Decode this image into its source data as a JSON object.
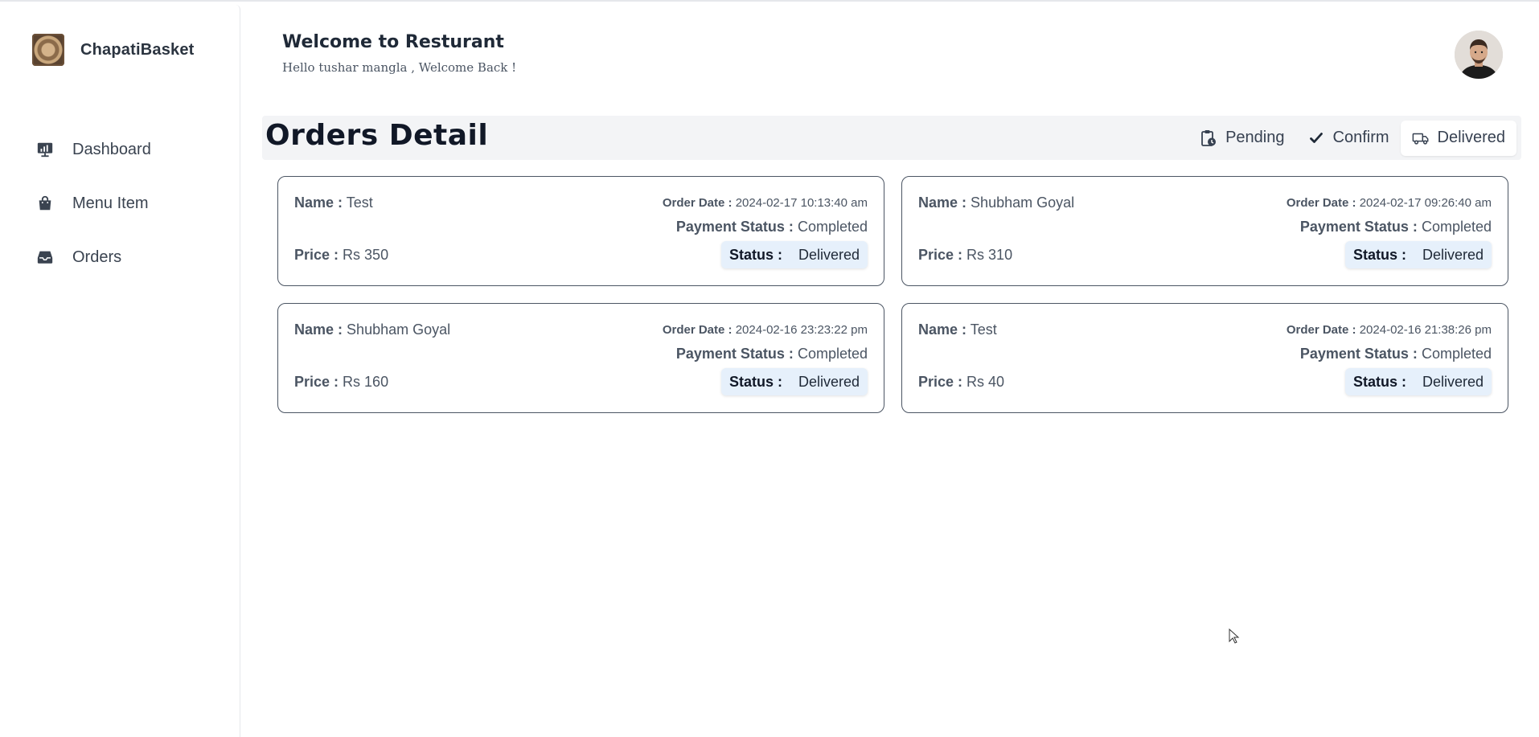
{
  "brand": {
    "name": "ChapatiBasket"
  },
  "sidebar": {
    "items": [
      {
        "label": "Dashboard",
        "icon": "dashboard-icon"
      },
      {
        "label": "Menu Item",
        "icon": "shopping-bag-icon"
      },
      {
        "label": "Orders",
        "icon": "inbox-icon"
      }
    ]
  },
  "header": {
    "title": "Welcome to Resturant",
    "subtitle": "Hello tushar mangla , Welcome Back !"
  },
  "orders": {
    "title": "Orders Detail",
    "tabs": [
      {
        "label": "Pending",
        "icon": "clipboard-clock-icon"
      },
      {
        "label": "Confirm",
        "icon": "check-icon"
      },
      {
        "label": "Delivered",
        "icon": "truck-icon",
        "active": true
      }
    ],
    "labels": {
      "name": "Name :",
      "price": "Price :",
      "order_date": "Order Date :",
      "payment_status": "Payment Status :",
      "status": "Status :"
    },
    "cards": [
      {
        "name": "Test",
        "price": "Rs 350",
        "order_date": "2024-02-17 10:13:40 am",
        "payment_status": "Completed",
        "status": "Delivered"
      },
      {
        "name": "Shubham Goyal",
        "price": "Rs 310",
        "order_date": "2024-02-17 09:26:40 am",
        "payment_status": "Completed",
        "status": "Delivered"
      },
      {
        "name": "Shubham Goyal",
        "price": "Rs 160",
        "order_date": "2024-02-16 23:23:22 pm",
        "payment_status": "Completed",
        "status": "Delivered"
      },
      {
        "name": "Test",
        "price": "Rs 40",
        "order_date": "2024-02-16 21:38:26 pm",
        "payment_status": "Completed",
        "status": "Delivered"
      }
    ]
  },
  "colors": {
    "status_badge_bg": "#e6f0fb",
    "orders_bar_bg": "#f3f4f6",
    "card_border": "#4b5563"
  }
}
